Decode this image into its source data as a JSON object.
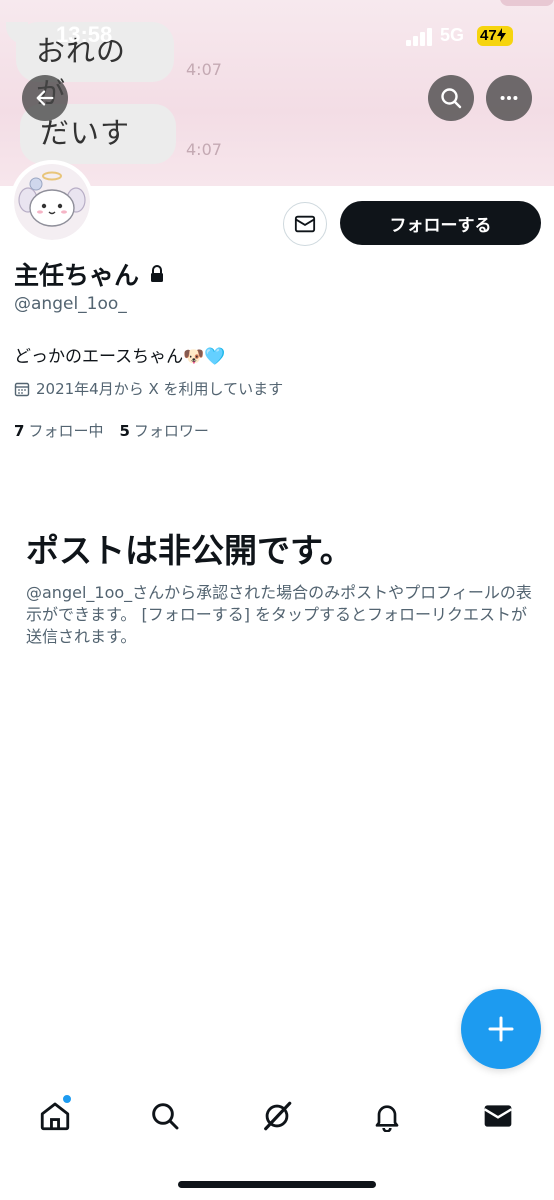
{
  "status_bar": {
    "time": "13:58",
    "network": "5G",
    "battery": "47"
  },
  "banner": {
    "bubbles": [
      {
        "text": "おれのが",
        "time": "4:07"
      },
      {
        "text": "だいすき",
        "time": "4:07"
      }
    ]
  },
  "header": {
    "back_icon": "arrow-left-icon",
    "search_icon": "search-icon",
    "more_icon": "more-horizontal-icon"
  },
  "profile": {
    "name": "主任ちゃん",
    "handle": "@angel_1oo_",
    "bio": "どっかのエースちゃん🐶🩵",
    "joined": "2021年4月から X を利用しています",
    "following_count": "7",
    "following_label": "フォロー中",
    "followers_count": "5",
    "followers_label": "フォロワー",
    "follow_button": "フォローする"
  },
  "private": {
    "title": "ポストは非公開です。",
    "description": "@angel_1oo_さんから承認された場合のみポストやプロフィールの表示ができます。 [フォローする] をタップするとフォローリクエストが送信されます。"
  },
  "tabs": [
    "home-icon",
    "search-icon",
    "grok-icon",
    "notifications-icon",
    "messages-icon"
  ],
  "colors": {
    "accent": "#1d9bf0",
    "text": "#0f1419",
    "secondary": "#536471",
    "banner": "#f3dde5"
  }
}
